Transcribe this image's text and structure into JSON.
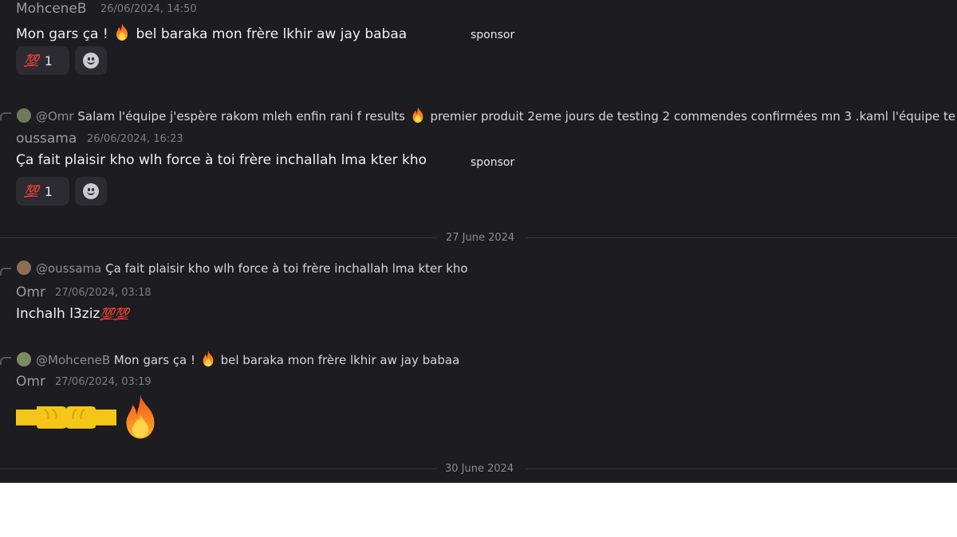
{
  "messages": [
    {
      "author": "MohceneB",
      "timestamp": "26/06/2024, 14:50",
      "text_before": "Mon gars ça !",
      "emoji": "fire-icon",
      "text_after": "bel baraka mon frère lkhir aw jay babaa",
      "sponsor": "sponsor",
      "reaction": {
        "emoji": "💯",
        "count": "1"
      }
    },
    {
      "reply": {
        "mention": "@Omr",
        "text_before": "Salam l'équipe j'espère rakom mleh enfin rani f results",
        "emoji": "fire-icon",
        "text_after": "premier produit 2eme jours de testing 2 commendes confirmées mn 3 .kaml l'équipe te"
      },
      "author": "oussama",
      "timestamp": "26/06/2024, 16:23",
      "text": "Ça fait plaisir kho wlh force à toi frère inchallah lma kter kho",
      "sponsor": "sponsor",
      "reaction": {
        "emoji": "💯",
        "count": "1"
      }
    },
    {
      "reply": {
        "mention": "@oussama",
        "text": "Ça fait plaisir kho wlh force à toi frère inchallah lma kter kho"
      },
      "author": "Omr",
      "timestamp": "27/06/2024, 03:18",
      "text": "Inchalh l3ziz",
      "emojis": "💯💯"
    },
    {
      "reply": {
        "mention": "@MohceneB",
        "text_before": "Mon gars ça !",
        "emoji": "fire-icon",
        "text_after": "bel baraka mon frère lkhir aw jay babaa"
      },
      "author": "Omr",
      "timestamp": "27/06/2024, 03:19",
      "big_emojis": [
        "fist-bump-icon",
        "fire-icon"
      ]
    }
  ],
  "date_separators": [
    "27 June 2024",
    "30 June 2024"
  ],
  "colors": {
    "background": "#1c1c21",
    "reaction_bg": "#2b2b31",
    "hundred_red": "#e0344a",
    "fire_orange": "#ff8a1c"
  }
}
